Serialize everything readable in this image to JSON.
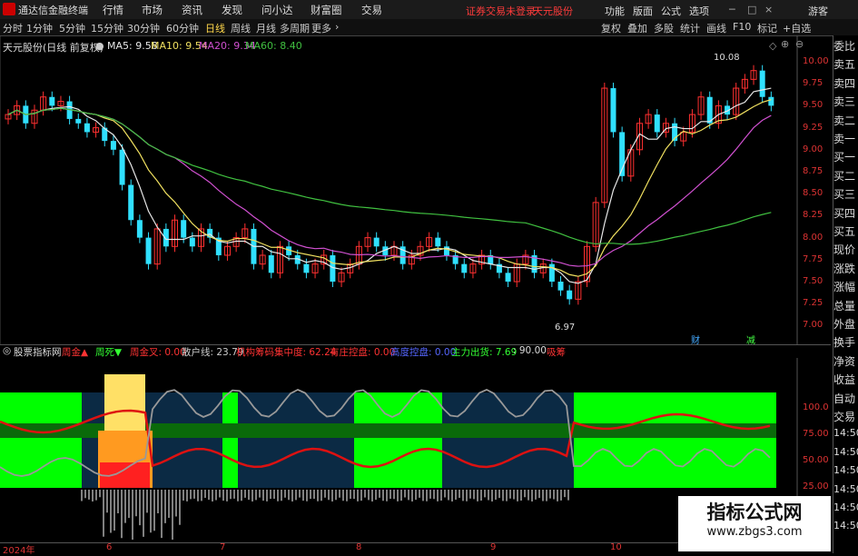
{
  "app_title": "通达信金融终端",
  "menu": [
    "行情",
    "市场",
    "资讯",
    "发现",
    "问小达",
    "财富圈",
    "交易"
  ],
  "login_status": "证券交易未登录",
  "stock_name_head": "天元股份",
  "right_menu": [
    "功能",
    "版面",
    "公式",
    "选项"
  ],
  "guest": "游客",
  "toolbar_periods": [
    "分时",
    "1分钟",
    "5分钟",
    "15分钟",
    "30分钟",
    "60分钟",
    "日线",
    "周线",
    "月线",
    "多周期",
    "更多"
  ],
  "active_period": "日线",
  "toolbar_right": [
    "复权",
    "叠加",
    "多股",
    "统计",
    "画线",
    "F10",
    "标记",
    "+自选"
  ],
  "stock_title": "天元股份(日线 前复权)",
  "ma": {
    "ma5": "MA5: 9.58",
    "ma10": "MA10: 9.54",
    "ma20": "MA20: 9.34",
    "ma60": "MA60: 8.40",
    "c5": "#e8e8e8",
    "c10": "#f0e060",
    "c20": "#d050d0",
    "c60": "#40c040"
  },
  "price_axis": [
    "10.00",
    "9.75",
    "9.50",
    "9.25",
    "9.00",
    "8.75",
    "8.50",
    "8.25",
    "8.00",
    "7.75",
    "7.50",
    "7.25",
    "7.00"
  ],
  "high_label": "10.08",
  "low_label": "6.97",
  "marker_a": "财",
  "marker_b": "减",
  "indicator": {
    "name": "股票指标网",
    "zhoujin": "周金▲",
    "zhousi": "周死▼",
    "zhoujincha": "周金叉: 0.00",
    "sanhu": "散户线: 23.79",
    "jigou": "机构筹码集中度: 62.24",
    "youzhuang": "有庄控盘: 0.00",
    "gaodu": "高度控盘: 0.00",
    "zhuli": "主力出货: 7.69",
    "v90": ": 90.00",
    "kongpan": "吸筹"
  },
  "ind_axis": [
    "100.0",
    "75.00",
    "50.00",
    "25.00",
    "0.00"
  ],
  "sidebar_items": [
    "委比",
    "卖五",
    "卖四",
    "卖三",
    "卖二",
    "卖一",
    "买一",
    "买二",
    "买三",
    "买四",
    "买五",
    "现价",
    "涨跌",
    "涨幅",
    "总量",
    "外盘",
    "换手",
    "净资",
    "收益",
    "自动",
    "交易",
    "14:50",
    "14:50",
    "14:50",
    "14:50",
    "14:50",
    "14:50"
  ],
  "x_axis": [
    [
      "2024年",
      3
    ],
    [
      "6",
      117
    ],
    [
      "7",
      242
    ],
    [
      "8",
      392
    ],
    [
      "9",
      540
    ],
    [
      "10",
      672
    ]
  ],
  "watermark_title": "指标公式网",
  "watermark_url": "www.zbgs3.com",
  "colors": {
    "up": "#ff3030",
    "down": "#30e0ff",
    "bg": "#000000"
  }
}
